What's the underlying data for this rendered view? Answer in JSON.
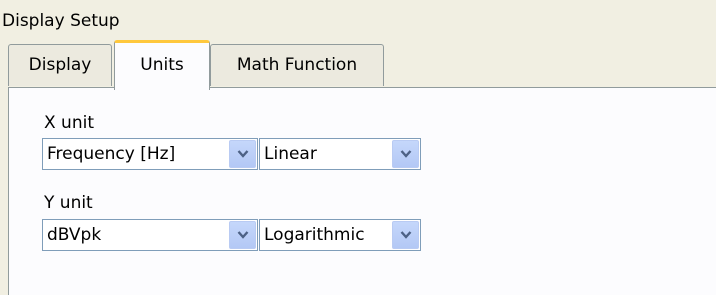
{
  "window": {
    "title": "Display Setup"
  },
  "tabs": [
    {
      "label": "Display",
      "active": false
    },
    {
      "label": "Units",
      "active": true
    },
    {
      "label": "Math Function",
      "active": false
    }
  ],
  "x_unit": {
    "label": "X unit",
    "quantity": {
      "value": "Frequency [Hz]",
      "icon": "chevron-down-icon"
    },
    "scale": {
      "value": "Linear",
      "icon": "chevron-down-icon"
    }
  },
  "y_unit": {
    "label": "Y unit",
    "quantity": {
      "value": "dBVpk",
      "icon": "chevron-down-icon"
    },
    "scale": {
      "value": "Logarithmic",
      "icon": "chevron-down-icon"
    }
  },
  "colors": {
    "active_tab_accent": "#ffc83c",
    "dropdown_button": "#c5d7fb",
    "field_border": "#7f9db9",
    "window_background": "#f1efe2"
  }
}
